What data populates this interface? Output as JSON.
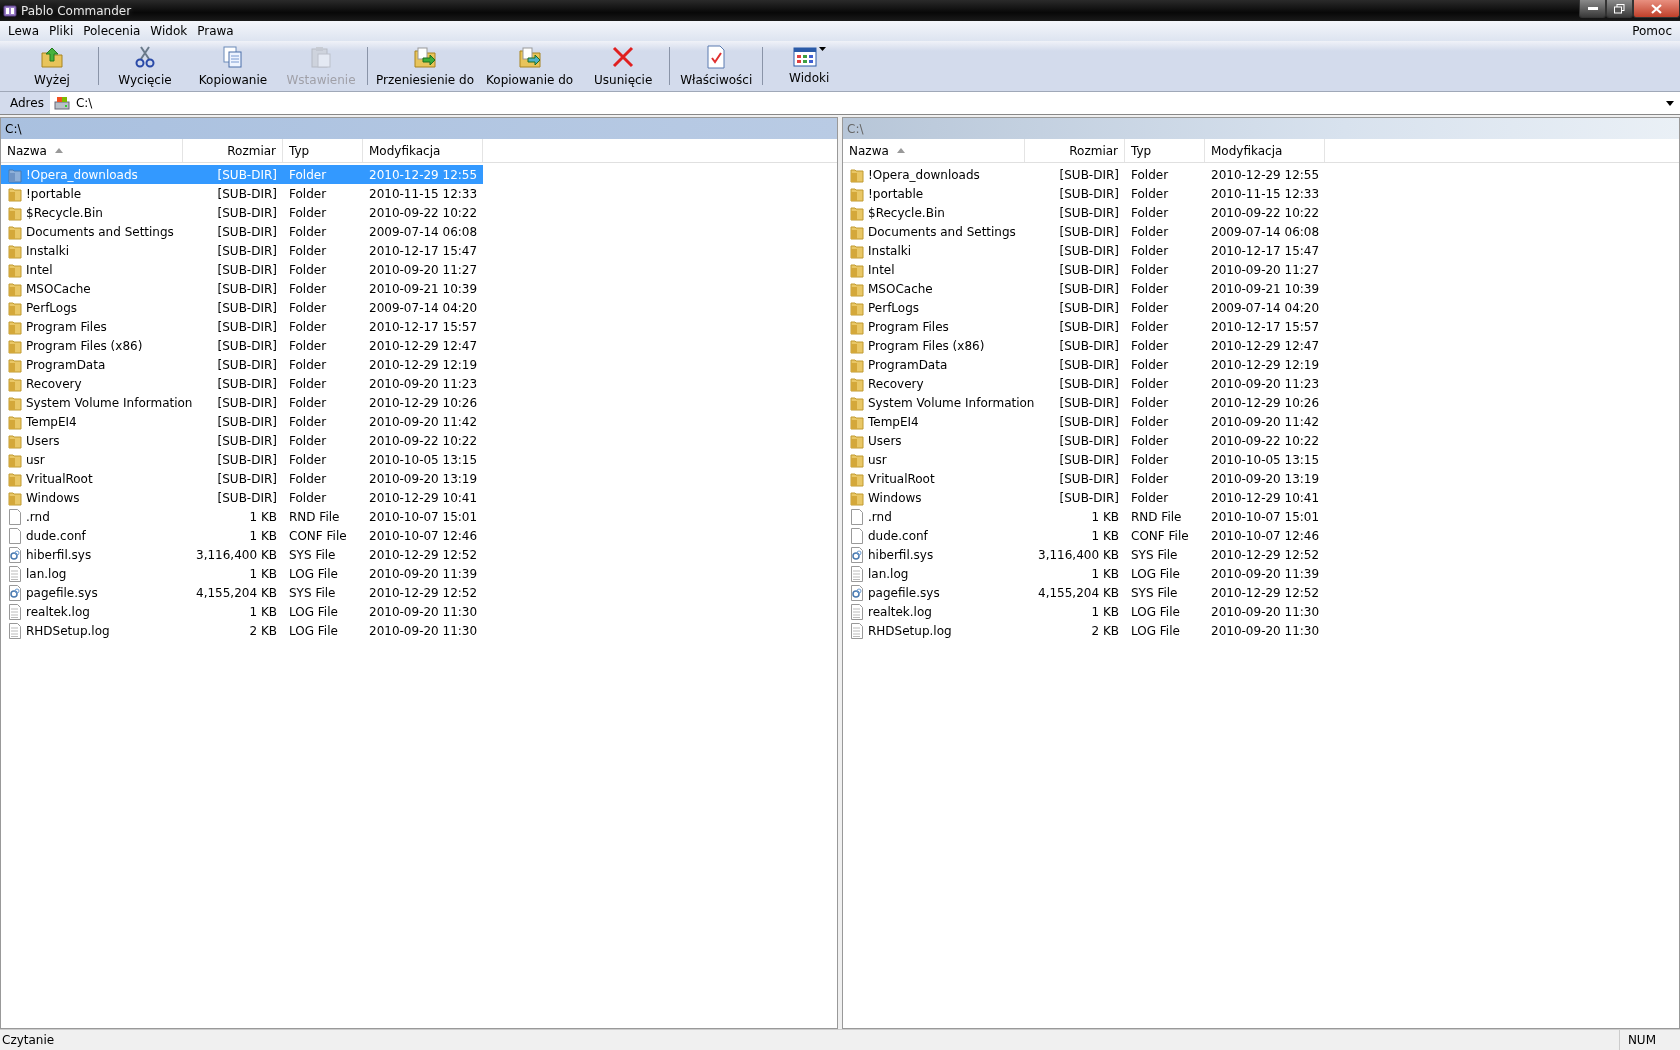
{
  "window": {
    "title": "Pablo Commander"
  },
  "menu_left": [
    "Lewa",
    "Pliki",
    "Polecenia",
    "Widok",
    "Prawa"
  ],
  "menu_right": [
    "Pomoc"
  ],
  "toolbar": [
    {
      "label": "Wyżej",
      "kind": "up",
      "disabled": false,
      "separator_after": true
    },
    {
      "label": "Wycięcie",
      "kind": "cut",
      "disabled": false,
      "separator_after": false
    },
    {
      "label": "Kopiowanie",
      "kind": "copy",
      "disabled": false,
      "separator_after": false
    },
    {
      "label": "Wstawienie",
      "kind": "paste",
      "disabled": true,
      "separator_after": true
    },
    {
      "label": "Przeniesienie do",
      "kind": "move",
      "disabled": false,
      "separator_after": false
    },
    {
      "label": "Kopiowanie do",
      "kind": "copyto",
      "disabled": false,
      "separator_after": false
    },
    {
      "label": "Usunięcie",
      "kind": "delete",
      "disabled": false,
      "separator_after": true
    },
    {
      "label": "Właściwości",
      "kind": "properties",
      "disabled": false,
      "separator_after": true
    },
    {
      "label": "Widoki",
      "kind": "views",
      "disabled": false,
      "separator_after": false
    }
  ],
  "address": {
    "label": "Adres",
    "value": "C:\\"
  },
  "panels": [
    {
      "path": "C:\\",
      "active": true,
      "columns": [
        "Nazwa",
        "Rozmiar",
        "Typ",
        "Modyfikacja"
      ],
      "rows": [
        {
          "name": "!Opera_downloads",
          "size": "[SUB-DIR]",
          "type": "Folder",
          "modified": "2010-12-29 12:55",
          "kind": "folder",
          "selected": true
        },
        {
          "name": "!portable",
          "size": "[SUB-DIR]",
          "type": "Folder",
          "modified": "2010-11-15 12:33",
          "kind": "folder",
          "selected": false
        },
        {
          "name": "$Recycle.Bin",
          "size": "[SUB-DIR]",
          "type": "Folder",
          "modified": "2010-09-22 10:22",
          "kind": "folder",
          "selected": false
        },
        {
          "name": "Documents and Settings",
          "size": "[SUB-DIR]",
          "type": "Folder",
          "modified": "2009-07-14 06:08",
          "kind": "folder",
          "selected": false
        },
        {
          "name": "Instalki",
          "size": "[SUB-DIR]",
          "type": "Folder",
          "modified": "2010-12-17 15:47",
          "kind": "folder",
          "selected": false
        },
        {
          "name": "Intel",
          "size": "[SUB-DIR]",
          "type": "Folder",
          "modified": "2010-09-20 11:27",
          "kind": "folder",
          "selected": false
        },
        {
          "name": "MSOCache",
          "size": "[SUB-DIR]",
          "type": "Folder",
          "modified": "2010-09-21 10:39",
          "kind": "folder",
          "selected": false
        },
        {
          "name": "PerfLogs",
          "size": "[SUB-DIR]",
          "type": "Folder",
          "modified": "2009-07-14 04:20",
          "kind": "folder",
          "selected": false
        },
        {
          "name": "Program Files",
          "size": "[SUB-DIR]",
          "type": "Folder",
          "modified": "2010-12-17 15:57",
          "kind": "folder",
          "selected": false
        },
        {
          "name": "Program Files (x86)",
          "size": "[SUB-DIR]",
          "type": "Folder",
          "modified": "2010-12-29 12:47",
          "kind": "folder",
          "selected": false
        },
        {
          "name": "ProgramData",
          "size": "[SUB-DIR]",
          "type": "Folder",
          "modified": "2010-12-29 12:19",
          "kind": "folder",
          "selected": false
        },
        {
          "name": "Recovery",
          "size": "[SUB-DIR]",
          "type": "Folder",
          "modified": "2010-09-20 11:23",
          "kind": "folder",
          "selected": false
        },
        {
          "name": "System Volume Information",
          "size": "[SUB-DIR]",
          "type": "Folder",
          "modified": "2010-12-29 10:26",
          "kind": "folder",
          "selected": false
        },
        {
          "name": "TempEI4",
          "size": "[SUB-DIR]",
          "type": "Folder",
          "modified": "2010-09-20 11:42",
          "kind": "folder",
          "selected": false
        },
        {
          "name": "Users",
          "size": "[SUB-DIR]",
          "type": "Folder",
          "modified": "2010-09-22 10:22",
          "kind": "folder",
          "selected": false
        },
        {
          "name": "usr",
          "size": "[SUB-DIR]",
          "type": "Folder",
          "modified": "2010-10-05 13:15",
          "kind": "folder",
          "selected": false
        },
        {
          "name": "VritualRoot",
          "size": "[SUB-DIR]",
          "type": "Folder",
          "modified": "2010-09-20 13:19",
          "kind": "folder",
          "selected": false
        },
        {
          "name": "Windows",
          "size": "[SUB-DIR]",
          "type": "Folder",
          "modified": "2010-12-29 10:41",
          "kind": "folder",
          "selected": false
        },
        {
          "name": ".rnd",
          "size": "1 KB",
          "type": "RND File",
          "modified": "2010-10-07 15:01",
          "kind": "file",
          "selected": false
        },
        {
          "name": "dude.conf",
          "size": "1 KB",
          "type": "CONF File",
          "modified": "2010-10-07 12:46",
          "kind": "file",
          "selected": false
        },
        {
          "name": "hiberfil.sys",
          "size": "3,116,400 KB",
          "type": "SYS File",
          "modified": "2010-12-29 12:52",
          "kind": "system",
          "selected": false
        },
        {
          "name": "lan.log",
          "size": "1 KB",
          "type": "LOG File",
          "modified": "2010-09-20 11:39",
          "kind": "text",
          "selected": false
        },
        {
          "name": "pagefile.sys",
          "size": "4,155,204 KB",
          "type": "SYS File",
          "modified": "2010-12-29 12:52",
          "kind": "system",
          "selected": false
        },
        {
          "name": "realtek.log",
          "size": "1 KB",
          "type": "LOG File",
          "modified": "2010-09-20 11:30",
          "kind": "text",
          "selected": false
        },
        {
          "name": "RHDSetup.log",
          "size": "2 KB",
          "type": "LOG File",
          "modified": "2010-09-20 11:30",
          "kind": "text",
          "selected": false
        }
      ]
    },
    {
      "path": "C:\\",
      "active": false,
      "columns": [
        "Nazwa",
        "Rozmiar",
        "Typ",
        "Modyfikacja"
      ],
      "rows": [
        {
          "name": "!Opera_downloads",
          "size": "[SUB-DIR]",
          "type": "Folder",
          "modified": "2010-12-29 12:55",
          "kind": "folder",
          "selected": false
        },
        {
          "name": "!portable",
          "size": "[SUB-DIR]",
          "type": "Folder",
          "modified": "2010-11-15 12:33",
          "kind": "folder",
          "selected": false
        },
        {
          "name": "$Recycle.Bin",
          "size": "[SUB-DIR]",
          "type": "Folder",
          "modified": "2010-09-22 10:22",
          "kind": "folder",
          "selected": false
        },
        {
          "name": "Documents and Settings",
          "size": "[SUB-DIR]",
          "type": "Folder",
          "modified": "2009-07-14 06:08",
          "kind": "folder",
          "selected": false
        },
        {
          "name": "Instalki",
          "size": "[SUB-DIR]",
          "type": "Folder",
          "modified": "2010-12-17 15:47",
          "kind": "folder",
          "selected": false
        },
        {
          "name": "Intel",
          "size": "[SUB-DIR]",
          "type": "Folder",
          "modified": "2010-09-20 11:27",
          "kind": "folder",
          "selected": false
        },
        {
          "name": "MSOCache",
          "size": "[SUB-DIR]",
          "type": "Folder",
          "modified": "2010-09-21 10:39",
          "kind": "folder",
          "selected": false
        },
        {
          "name": "PerfLogs",
          "size": "[SUB-DIR]",
          "type": "Folder",
          "modified": "2009-07-14 04:20",
          "kind": "folder",
          "selected": false
        },
        {
          "name": "Program Files",
          "size": "[SUB-DIR]",
          "type": "Folder",
          "modified": "2010-12-17 15:57",
          "kind": "folder",
          "selected": false
        },
        {
          "name": "Program Files (x86)",
          "size": "[SUB-DIR]",
          "type": "Folder",
          "modified": "2010-12-29 12:47",
          "kind": "folder",
          "selected": false
        },
        {
          "name": "ProgramData",
          "size": "[SUB-DIR]",
          "type": "Folder",
          "modified": "2010-12-29 12:19",
          "kind": "folder",
          "selected": false
        },
        {
          "name": "Recovery",
          "size": "[SUB-DIR]",
          "type": "Folder",
          "modified": "2010-09-20 11:23",
          "kind": "folder",
          "selected": false
        },
        {
          "name": "System Volume Information",
          "size": "[SUB-DIR]",
          "type": "Folder",
          "modified": "2010-12-29 10:26",
          "kind": "folder",
          "selected": false
        },
        {
          "name": "TempEI4",
          "size": "[SUB-DIR]",
          "type": "Folder",
          "modified": "2010-09-20 11:42",
          "kind": "folder",
          "selected": false
        },
        {
          "name": "Users",
          "size": "[SUB-DIR]",
          "type": "Folder",
          "modified": "2010-09-22 10:22",
          "kind": "folder",
          "selected": false
        },
        {
          "name": "usr",
          "size": "[SUB-DIR]",
          "type": "Folder",
          "modified": "2010-10-05 13:15",
          "kind": "folder",
          "selected": false
        },
        {
          "name": "VritualRoot",
          "size": "[SUB-DIR]",
          "type": "Folder",
          "modified": "2010-09-20 13:19",
          "kind": "folder",
          "selected": false
        },
        {
          "name": "Windows",
          "size": "[SUB-DIR]",
          "type": "Folder",
          "modified": "2010-12-29 10:41",
          "kind": "folder",
          "selected": false
        },
        {
          "name": ".rnd",
          "size": "1 KB",
          "type": "RND File",
          "modified": "2010-10-07 15:01",
          "kind": "file",
          "selected": false
        },
        {
          "name": "dude.conf",
          "size": "1 KB",
          "type": "CONF File",
          "modified": "2010-10-07 12:46",
          "kind": "file",
          "selected": false
        },
        {
          "name": "hiberfil.sys",
          "size": "3,116,400 KB",
          "type": "SYS File",
          "modified": "2010-12-29 12:52",
          "kind": "system",
          "selected": false
        },
        {
          "name": "lan.log",
          "size": "1 KB",
          "type": "LOG File",
          "modified": "2010-09-20 11:39",
          "kind": "text",
          "selected": false
        },
        {
          "name": "pagefile.sys",
          "size": "4,155,204 KB",
          "type": "SYS File",
          "modified": "2010-12-29 12:52",
          "kind": "system",
          "selected": false
        },
        {
          "name": "realtek.log",
          "size": "1 KB",
          "type": "LOG File",
          "modified": "2010-09-20 11:30",
          "kind": "text",
          "selected": false
        },
        {
          "name": "RHDSetup.log",
          "size": "2 KB",
          "type": "LOG File",
          "modified": "2010-09-20 11:30",
          "kind": "text",
          "selected": false
        }
      ]
    }
  ],
  "status_bar": {
    "text": "Czytanie",
    "indicator": "NUM"
  }
}
